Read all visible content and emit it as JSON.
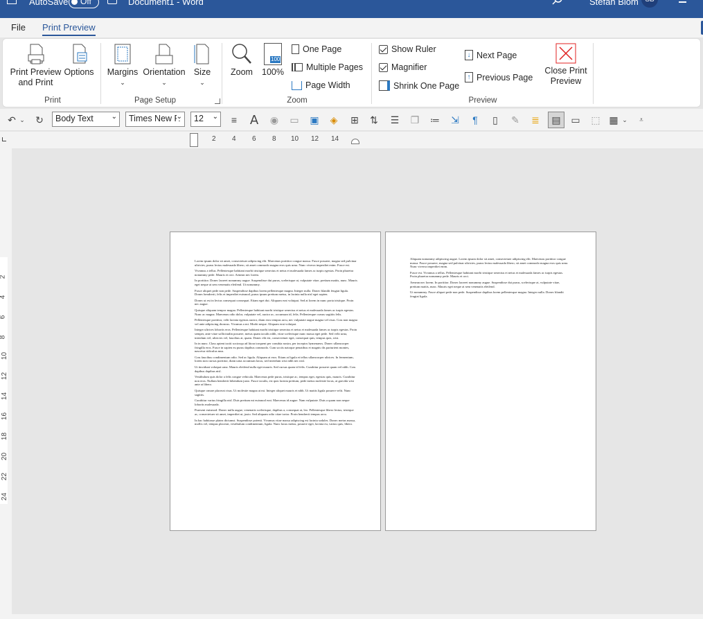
{
  "title_bar": {
    "autosave_label": "AutoSave",
    "autosave_state": "Off",
    "document_title": "Document1 - Word",
    "user_name": "Stefan Blom",
    "user_initials": "SB"
  },
  "tabs": [
    {
      "label": "File",
      "active": false
    },
    {
      "label": "Print Preview",
      "active": true
    }
  ],
  "ribbon": {
    "print_group": {
      "label": "Print",
      "print_preview_and_print": "Print Preview and Print",
      "options": "Options"
    },
    "page_setup_group": {
      "label": "Page Setup",
      "margins": "Margins",
      "orientation": "Orientation",
      "size": "Size"
    },
    "zoom_group": {
      "label": "Zoom",
      "zoom": "Zoom",
      "zoom_100": "100%",
      "zoom_100_icon_text": "100",
      "one_page": "One Page",
      "multiple_pages": "Multiple Pages",
      "page_width": "Page Width"
    },
    "preview_group": {
      "label": "Preview",
      "show_ruler": "Show Ruler",
      "show_ruler_checked": true,
      "magnifier": "Magnifier",
      "magnifier_checked": true,
      "shrink_one_page": "Shrink One Page",
      "next_page": "Next Page",
      "previous_page": "Previous Page",
      "close_print_preview": "Close Print Preview"
    }
  },
  "quick_access": {
    "style": "Body Text",
    "font": "Times New R",
    "font_size": "12"
  },
  "ruler": {
    "horizontal_ticks": [
      "2",
      "4",
      "6",
      "8",
      "10",
      "12",
      "14"
    ],
    "vertical_ticks": [
      "2",
      "4",
      "6",
      "8",
      "10",
      "12",
      "14",
      "16",
      "18",
      "20",
      "22",
      "24"
    ]
  },
  "page1_paragraphs": [
    "Lorem ipsum dolor sit amet, consectetuer adipiscing elit. Maecenas porttitor congue massa. Fusce posuere, magna sed pulvinar ultricies, purus lectus malesuada libero, sit amet commodo magna eros quis urna. Nunc viverra imperdiet enim. Fusce est.",
    "Vivamus a tellus. Pellentesque habitant morbi tristique senectus et netus et malesuada fames ac turpis egestas. Proin pharetra nonummy pede. Mauris et orci. Aenean nec lorem.",
    "In porttitor. Donec laoreet nonummy augue. Suspendisse dui purus, scelerisque at, vulputate vitae, pretium mattis, nunc. Mauris eget neque at sem venenatis eleifend. Ut nonummy.",
    "Fusce aliquet pede non pede. Suspendisse dapibus lorem pellentesque magna. Integer nulla. Donec blandit feugiat ligula. Donec hendrerit, felis et imperdiet euismod, purus ipsum pretium metus, in lacinia nulla nisl eget sapien.",
    "Donec ut est in lectus consequat consequat. Etiam eget dui. Aliquam erat volutpat. Sed at lorem in nunc porta tristique. Proin nec augue.",
    "Quisque aliquam tempor magna. Pellentesque habitant morbi tristique senectus et netus et malesuada fames ac turpis egestas. Nunc ac magna. Maecenas odio dolor, vulputate vel, auctor ac, accumsan id, felis. Pellentesque cursus sagittis felis.",
    "Pellentesque porttitor, velit lacinia egestas auctor, diam eros tempus arcu, nec vulputate augue magna vel risus. Cras non magna vel ante adipiscing rhoncus. Vivamus a mi. Morbi neque. Aliquam erat volutpat.",
    "Integer ultrices lobortis eros. Pellentesque habitant morbi tristique senectus et netus et malesuada fames ac turpis egestas. Proin semper, ante vitae sollicitudin posuere, metus quam iaculis nibh, vitae scelerisque nunc massa eget pede. Sed velit urna, interdum vel, ultricies vel, faucibus at, quam. Donec elit est, consectetuer eget, consequat quis, tempus quis, wisi.",
    "In in nunc. Class aptent taciti sociosqu ad litora torquent per conubia nostra, per inceptos hymenaeos. Donec ullamcorper fringilla eros. Fusce in sapien eu purus dapibus commodo. Cum sociis natoque penatibus et magnis dis parturient montes, nascetur ridiculus mus.",
    "Cras faucibus condimentum odio. Sed ac ligula. Aliquam at eros. Etiam at ligula et tellus ullamcorper ultrices. In fermentum, lorem non cursus porttitor, diam urna accumsan lacus, sed interdum wisi nibh nec nisl.",
    "Ut tincidunt volutpat urna. Mauris eleifend nulla eget mauris. Sed cursus quam id felis. Curabitur posuere quam vel nibh. Cras dapibus dapibus nisl.",
    "Vestibulum quis dolor a felis congue vehicula. Maecenas pede purus, tristique ac, tempus eget, egestas quis, mauris. Curabitur non eros. Nullam hendrerit bibendum justo. Fusce iaculis, est quis lacinia pretium, pede metus molestie lacus, at gravida wisi ante at libero.",
    "Quisque ornare placerat risus. Ut molestie magna at mi. Integer aliquet mauris et nibh. Ut mattis ligula posuere velit. Nunc sagittis.",
    "Curabitur varius fringilla nisl. Duis pretium mi euismod erat. Maecenas id augue. Nam vulputate. Duis a quam non neque lobortis malesuada.",
    "Praesent euismod. Donec nulla augue, venenatis scelerisque, dapibus a, consequat at, leo. Pellentesque libero lectus, tristique ac, consectetuer sit amet, imperdiet ut, justo. Sed aliquam odio vitae tortor. Proin hendrerit tempus arcu.",
    "In hac habitasse platea dictumst. Suspendisse potenti. Vivamus vitae massa adipiscing est lacinia sodales. Donec metus massa, mollis vel, tempus placerat, vestibulum condimentum, ligula. Nunc lacus metus, posuere eget, lacinia eu, varius quis, libero."
  ],
  "page2_paragraphs": [
    "Aliquam nonummy adipiscing augue. Lorem ipsum dolor sit amet, consectetuer adipiscing elit. Maecenas porttitor congue massa. Fusce posuere, magna sed pulvinar ultricies, purus lectus malesuada libero, sit amet commodo magna eros quis urna. Nunc viverra imperdiet enim.",
    "Fusce est. Vivamus a tellus. Pellentesque habitant morbi tristique senectus et netus et malesuada fames ac turpis egestas. Proin pharetra nonummy pede. Mauris et orci.",
    "Aenean nec lorem. In porttitor. Donec laoreet nonummy augue. Suspendisse dui purus, scelerisque at, vulputate vitae, pretium mattis, nunc. Mauris eget neque at sem venenatis eleifend.",
    "Ut nonummy. Fusce aliquet pede non pede. Suspendisse dapibus lorem pellentesque magna. Integer nulla. Donec blandit feugiat ligula."
  ],
  "colors": {
    "title_bar": "#2b579a",
    "accent": "#2b579a",
    "close_icon": "#e02020"
  }
}
